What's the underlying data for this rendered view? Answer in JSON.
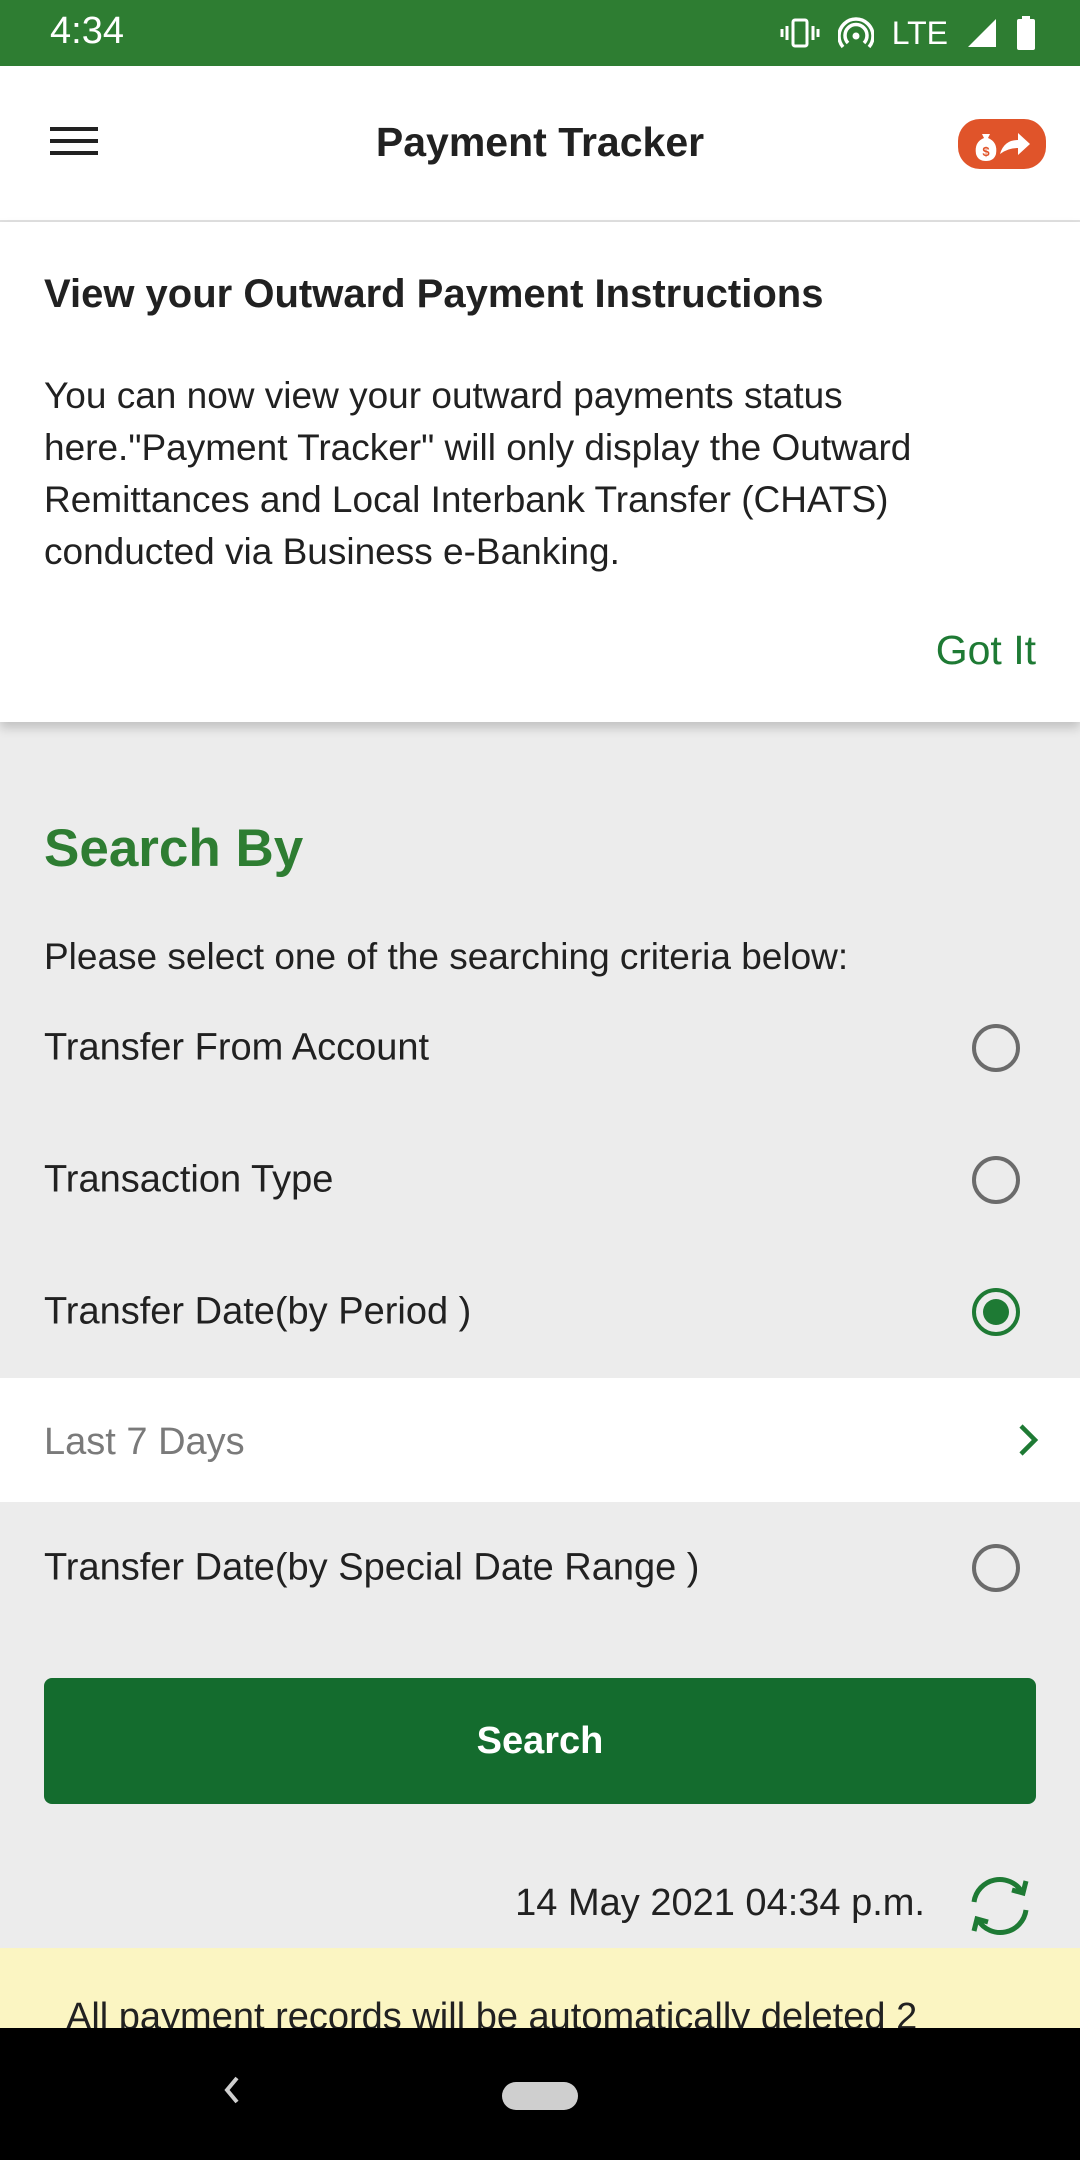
{
  "status_bar": {
    "time": "4:34",
    "network": "LTE",
    "icons": [
      "vibrate-icon",
      "hotspot-icon",
      "signal-icon",
      "battery-icon"
    ]
  },
  "app_bar": {
    "title": "Payment Tracker",
    "menu_icon": "hamburger-menu-icon",
    "action_icon": "money-transfer-icon"
  },
  "info_card": {
    "heading": "View your Outward Payment Instructions",
    "body": "You can now view your outward payments status here.\"Payment Tracker\" will only display the Outward Remittances and Local Interbank Transfer (CHATS) conducted via Business e-Banking.",
    "action": "Got It"
  },
  "search": {
    "heading": "Search By",
    "instruction": "Please select one of the searching criteria below:",
    "options": [
      {
        "label": "Transfer From Account",
        "selected": false
      },
      {
        "label": "Transaction Type",
        "selected": false
      },
      {
        "label": "Transfer Date(by Period )",
        "selected": true
      },
      {
        "label": "Transfer Date(by Special Date Range )",
        "selected": false
      }
    ],
    "period_value": "Last 7 Days",
    "button": "Search"
  },
  "last_updated": "14 May 2021 04:34 p.m.",
  "notice": "All payment records will be automatically deleted 2",
  "colors": {
    "status_bar": "#2e7d32",
    "accent_green": "#1e7a34",
    "button_green": "#146c2e",
    "action_orange": "#e0542a",
    "notice_bg": "#fbf5c2"
  }
}
